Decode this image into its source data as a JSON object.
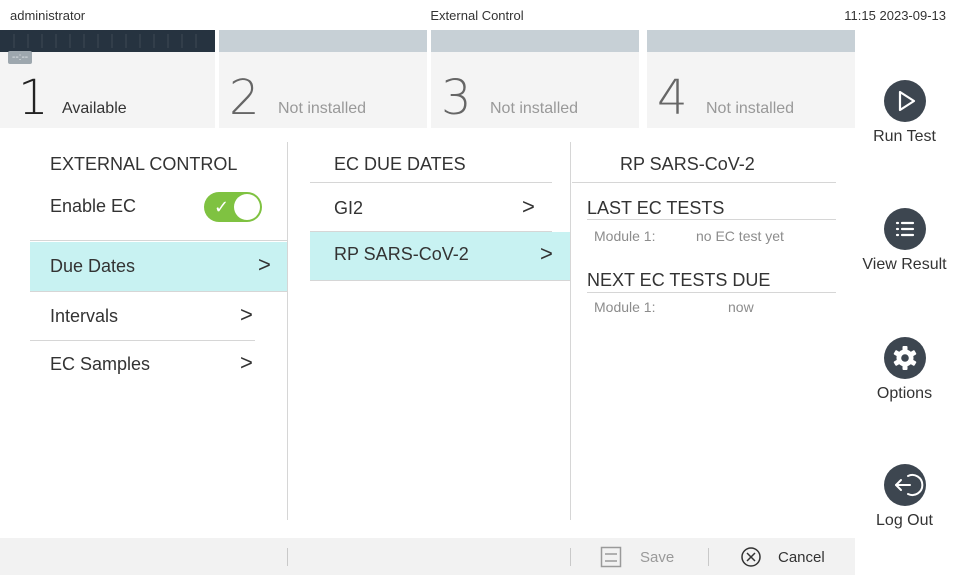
{
  "status": {
    "user": "administrator",
    "screen_title": "External Control",
    "time": "11:15",
    "date": "2023-09-13"
  },
  "modules": [
    {
      "number": "1",
      "state": "Available",
      "timer": "--:--"
    },
    {
      "number": "2",
      "state": "Not installed"
    },
    {
      "number": "3",
      "state": "Not installed"
    },
    {
      "number": "4",
      "state": "Not installed"
    }
  ],
  "sidebar": {
    "run_test": "Run Test",
    "view_result": "View Result",
    "options": "Options",
    "log_out": "Log Out"
  },
  "settings_menu": {
    "header": "EXTERNAL CONTROL",
    "enable_ec": {
      "label": "Enable EC",
      "enabled": true
    },
    "items": [
      {
        "label": "Due Dates",
        "selected": true
      },
      {
        "label": "Intervals",
        "selected": false
      },
      {
        "label": "EC Samples",
        "selected": false
      }
    ]
  },
  "due_dates": {
    "header": "EC DUE DATES",
    "items": [
      {
        "label": "GI2",
        "selected": false
      },
      {
        "label": "RP SARS-CoV-2",
        "selected": true
      }
    ]
  },
  "detail": {
    "header": "RP SARS-CoV-2",
    "last_tests": {
      "title": "LAST EC TESTS",
      "rows": [
        {
          "key": "Module 1:",
          "value": "no EC test yet"
        }
      ]
    },
    "next_due": {
      "title": "NEXT EC TESTS DUE",
      "rows": [
        {
          "key": "Module 1:",
          "value": "now"
        }
      ]
    }
  },
  "footer": {
    "save_label": "Save",
    "cancel_label": "Cancel",
    "save_enabled": false
  },
  "colors": {
    "selected_row": "#c8f2f2",
    "toggle_on": "#7fc241",
    "icon_circle": "#3d4650",
    "module_active_strip": "#263340"
  },
  "icons": {
    "run_test": "play-icon",
    "view_result": "list-icon",
    "options": "gear-icon",
    "log_out": "logout-arrow-icon",
    "save": "floppy-disk-icon",
    "cancel": "circle-x-icon",
    "chevron": "chevron-right-icon"
  }
}
